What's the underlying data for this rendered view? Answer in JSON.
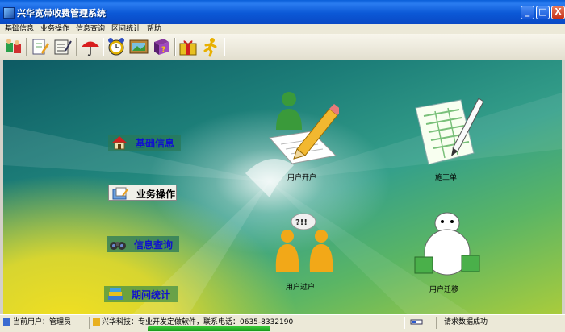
{
  "window": {
    "title": "兴华宽带收费管理系统",
    "minimize_label": "_",
    "maximize_label": "□",
    "close_label": "X"
  },
  "menu": [
    "基础信息",
    "业务操作",
    "信息查询",
    "区间统计",
    "帮助"
  ],
  "toolbar": {
    "icons": [
      "users-icon",
      "document-edit-icon",
      "list-icon",
      "umbrella-icon",
      "alarm-clock-icon",
      "picture-icon",
      "help-book-icon",
      "gift-icon",
      "running-man-icon"
    ]
  },
  "side_nav": [
    {
      "label": "基础信息",
      "icon": "house-icon"
    },
    {
      "label": "业务操作",
      "icon": "folder-icon"
    },
    {
      "label": "信息查询",
      "icon": "binoculars-icon"
    },
    {
      "label": "期间统计",
      "icon": "stack-icon"
    }
  ],
  "features": [
    {
      "label": "用户开户",
      "icon": "user-signup-icon"
    },
    {
      "label": "施工单",
      "icon": "worksheet-icon"
    },
    {
      "label": "用户过户",
      "icon": "user-transfer-icon"
    },
    {
      "label": "用户迁移",
      "icon": "user-move-icon"
    }
  ],
  "bubble_text": "?!!",
  "status": {
    "user": "当前用户：管理员",
    "company": "兴华科技：专业开发定做软件，联系电话：0635-8332190",
    "message": "请求数据成功"
  }
}
